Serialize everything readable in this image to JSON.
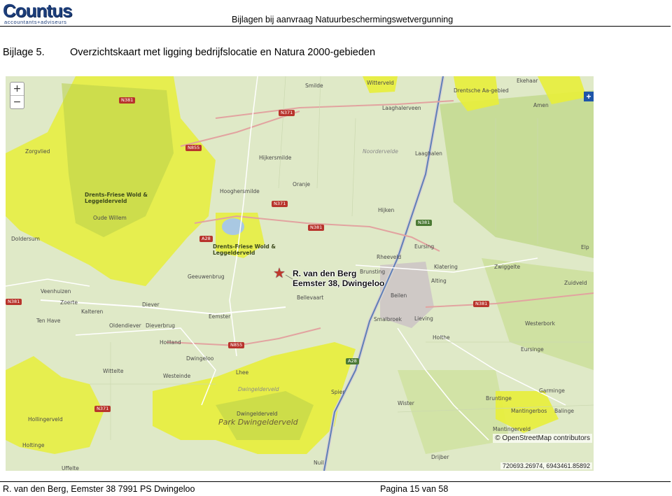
{
  "header": {
    "logo_name": "Countus",
    "logo_tagline": "accountants+adviseurs",
    "title": "Bijlagen bij aanvraag Natuurbeschermingswetvergunning"
  },
  "section": {
    "number": "Bijlage 5.",
    "title": "Overzichtskaart met ligging bedrijfslocatie en Natura 2000-gebieden"
  },
  "map": {
    "zoom_in": "+",
    "zoom_out": "−",
    "layers": "+",
    "location_label_line1": "R. van den Berg",
    "location_label_line2": "Eemster 38, Dwingeloo",
    "attribution": "© OpenStreetMap contributors",
    "coordinates": "720693.26974, 6943461.85892",
    "places": [
      "Smilde",
      "Witterveld",
      "Drentsche Aa-gebied",
      "Ekehaar",
      "Amen",
      "Laaghalerveen",
      "Zorgvlied",
      "Hijkersmilde",
      "Noordervelde",
      "Laaghalen",
      "Oranje",
      "Hooghersmilde",
      "Drents-Friese Wold & Leggelderveld",
      "Oude Willem",
      "Doldersum",
      "Hijken",
      "Drents-Friese Wold & Leggelderveld",
      "Rheeveld",
      "Eursing",
      "Geeuwenbrug",
      "Brunsting",
      "Klatering",
      "Zwiggelte",
      "Alting",
      "Zuidveld",
      "Veenhuizen",
      "Zoerte",
      "Bellevaart",
      "Beilen",
      "Kalteren",
      "Diever",
      "Smalbroek",
      "Lieving",
      "Westerbork",
      "Ten Have",
      "Oldendiever",
      "Dieverbrug",
      "Eemster",
      "Holthe",
      "Hoilland",
      "Eursinge",
      "Dwingeloo",
      "Wittelte",
      "Westeinde",
      "Lhee",
      "Garminge",
      "Dwingelderveld",
      "Spier",
      "Wister",
      "Bruntinge",
      "Mantingerbos",
      "Balinge",
      "Hollingerveld",
      "Dwingelderveld",
      "Park Dwingelderveld",
      "Mantingerveld",
      "Holtinge",
      "Uffelte",
      "Nuil",
      "Drijber",
      "Elp"
    ],
    "roads": [
      "N381",
      "N371",
      "N855",
      "N371",
      "N381",
      "N381",
      "A28",
      "N381",
      "N855",
      "A28",
      "N371",
      "N381"
    ]
  },
  "footer": {
    "left": "R. van den Berg, Eemster 38  7991 PS Dwingeloo",
    "right": "Pagina 15 van 58"
  },
  "colors": {
    "natura_yellow": "#e8ee3a",
    "forest_green": "#b5d17e",
    "background_green": "#dfe9c7",
    "star": "#c0392b",
    "logo_blue": "#1c3d7a"
  }
}
